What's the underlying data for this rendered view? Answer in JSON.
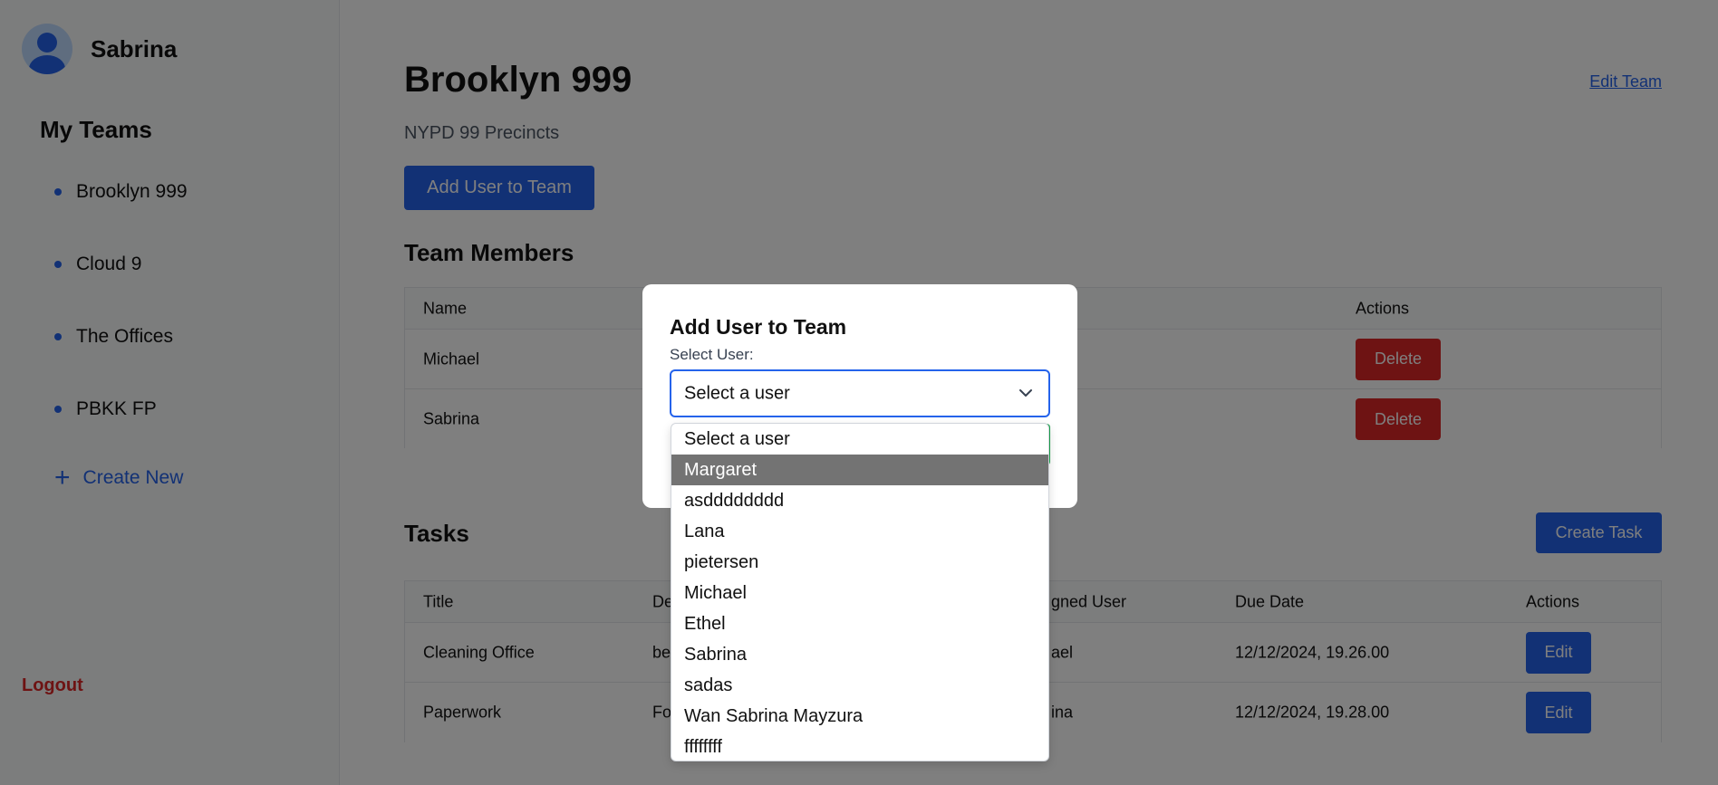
{
  "sidebar": {
    "user_name": "Sabrina",
    "section_title": "My Teams",
    "teams": [
      "Brooklyn 999",
      "Cloud 9",
      "The Offices",
      "PBKK FP"
    ],
    "create_new": "Create New",
    "logout": "Logout"
  },
  "team": {
    "title": "Brooklyn 999",
    "description": "NYPD 99 Precincts",
    "edit_link": "Edit Team",
    "add_user_button": "Add User to Team"
  },
  "members": {
    "title": "Team Members",
    "columns": [
      "Name",
      "Actions"
    ],
    "rows": [
      {
        "name": "Michael",
        "action": "Delete"
      },
      {
        "name": "Sabrina",
        "action": "Delete"
      }
    ]
  },
  "tasks": {
    "title": "Tasks",
    "create_button": "Create Task",
    "columns": [
      "Title",
      "De",
      "gned User",
      "Due Date",
      "Actions"
    ],
    "rows": [
      {
        "title": "Cleaning Office",
        "desc": "be",
        "user": "ael",
        "due": "12/12/2024, 19.26.00",
        "action": "Edit"
      },
      {
        "title": "Paperwork",
        "desc": "Fo",
        "user": "ina",
        "due": "12/12/2024, 19.28.00",
        "action": "Edit"
      }
    ]
  },
  "modal": {
    "title": "Add User to Team",
    "label": "Select User:",
    "selected": "Select a user",
    "options": [
      "Select a user",
      "Margaret",
      "asdddddddd",
      "Lana",
      "pietersen",
      "Michael",
      "Ethel",
      "Sabrina",
      "sadas",
      "Wan Sabrina Mayzura",
      "ffffffff"
    ],
    "highlighted_option": "Margaret"
  },
  "colors": {
    "primary": "#2563eb",
    "danger": "#dc2626",
    "overlay": "rgba(0,0,0,0.5)"
  }
}
